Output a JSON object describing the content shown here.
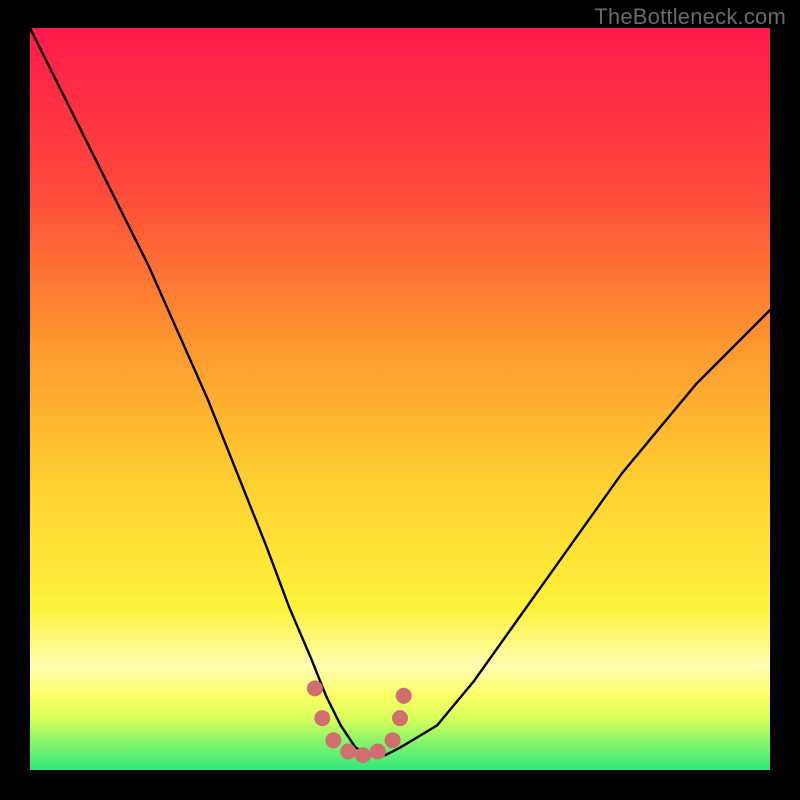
{
  "watermark": "TheBottleneck.com",
  "colors": {
    "frame": "#000000",
    "curve": "#000000",
    "dots": "#cf6f6f",
    "gradient_top": "#ff1a4b",
    "gradient_mid1": "#ff6a2e",
    "gradient_mid2": "#ffb02f",
    "gradient_mid3": "#ffe63a",
    "gradient_band_light": "#ffffb0",
    "gradient_bottom": "#2fe87a"
  },
  "chart_data": {
    "type": "line",
    "title": "",
    "xlabel": "",
    "ylabel": "",
    "xlim": [
      0,
      100
    ],
    "ylim": [
      0,
      100
    ],
    "series": [
      {
        "name": "bottleneck-curve",
        "x": [
          0,
          4,
          8,
          12,
          16,
          20,
          24,
          28,
          32,
          35,
          38,
          40,
          42,
          44,
          46,
          48,
          50,
          55,
          60,
          65,
          70,
          75,
          80,
          85,
          90,
          95,
          100
        ],
        "y": [
          100,
          92,
          84,
          76,
          68,
          59,
          50,
          40,
          30,
          22,
          15,
          10,
          6,
          3,
          2,
          2,
          3,
          6,
          12,
          19,
          26,
          33,
          40,
          46,
          52,
          57,
          62
        ]
      }
    ],
    "flat_region": {
      "x_start": 40,
      "x_end": 50,
      "y": 2.5
    },
    "dots": [
      {
        "x": 38.5,
        "y": 11
      },
      {
        "x": 39.5,
        "y": 7
      },
      {
        "x": 41,
        "y": 4
      },
      {
        "x": 43,
        "y": 2.5
      },
      {
        "x": 45,
        "y": 2
      },
      {
        "x": 47,
        "y": 2.5
      },
      {
        "x": 49,
        "y": 4
      },
      {
        "x": 50,
        "y": 7
      },
      {
        "x": 50.5,
        "y": 10
      }
    ]
  }
}
